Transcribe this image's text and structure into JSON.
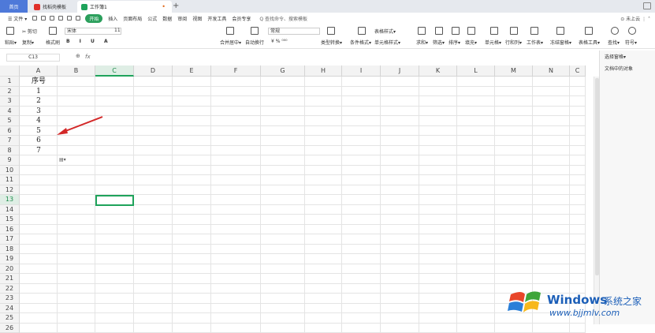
{
  "tabs": {
    "home": "首页",
    "template": "找稻壳模板",
    "workbook": "工作簿1",
    "close": "•",
    "new": "+"
  },
  "menu": {
    "file": "☰ 文件 ▾",
    "start": "开始",
    "items": [
      "插入",
      "页面布局",
      "公式",
      "数据",
      "审阅",
      "视图",
      "开发工具",
      "会员专享"
    ],
    "search": "Q 查找命令、搜索模板",
    "right": "⊙ 未上云  ⋮ ˄"
  },
  "ribbon": {
    "paste": "粘贴▾",
    "cut": "✂ 剪切",
    "copy": "复制▾",
    "format_painter": "格式刷",
    "font": "宋体",
    "size": "11",
    "merge": "合并居中▾",
    "wrap": "自动换行",
    "number_format": "常规",
    "table_style": "表格样式▾",
    "cond_format": "条件格式▾",
    "cell_style": "单元格样式▾",
    "convert": "类型转换▾",
    "sum": "求和▾",
    "filter": "筛选▾",
    "sort": "排序▾",
    "fill": "填充▾",
    "cells": "单元格▾",
    "rowcol": "行和列▾",
    "sheet": "工作表▾",
    "freeze": "冻结窗格▾",
    "table_tools": "表格工具▾",
    "find": "查找▾",
    "symbol": "符号▾"
  },
  "formula": {
    "cell_ref": "C13",
    "fx": "fx",
    "zoom": "⊕"
  },
  "columns": [
    "A",
    "B",
    "C",
    "D",
    "E",
    "F",
    "G",
    "H",
    "I",
    "J",
    "K",
    "L",
    "M",
    "N",
    "C"
  ],
  "rows": [
    "1",
    "2",
    "3",
    "4",
    "5",
    "6",
    "7",
    "8",
    "9",
    "10",
    "11",
    "12",
    "13",
    "14",
    "15",
    "16",
    "17",
    "18",
    "19",
    "20",
    "21",
    "22",
    "23",
    "24",
    "25",
    "26"
  ],
  "cells": {
    "A1": "序号",
    "A2": "1",
    "A3": "2",
    "A4": "3",
    "A5": "4",
    "A6": "5",
    "A7": "6",
    "A8": "7"
  },
  "paste_options": "▤▾",
  "taskpane": {
    "select_pane": "选择窗格▾",
    "objects": "文档中的对象"
  },
  "watermark": {
    "brand": "Windows",
    "suffix": "系统之家",
    "url": "www.bjjmlv.com"
  }
}
